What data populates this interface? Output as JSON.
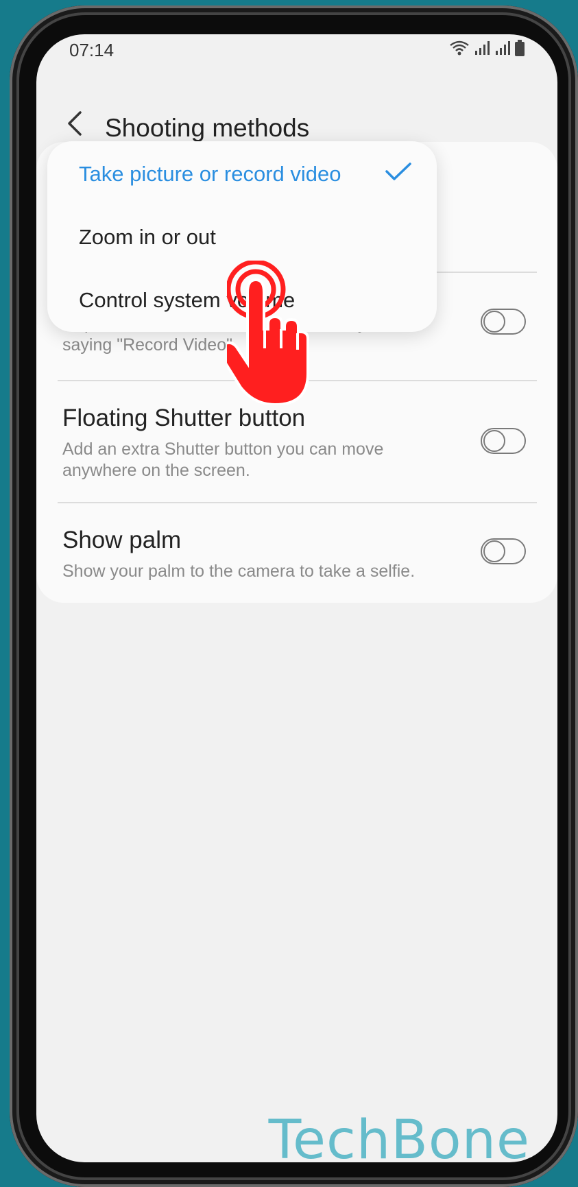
{
  "status": {
    "time": "07:14"
  },
  "header": {
    "title": "Shooting methods"
  },
  "popup": {
    "options": [
      {
        "label": "Take picture or record video",
        "selected": true
      },
      {
        "label": "Zoom in or out",
        "selected": false
      },
      {
        "label": "Control system volume",
        "selected": false
      }
    ]
  },
  "settings": {
    "hidden_desc_partial": "Capture\", or \"Shoot\" or record videos by saying \"Record Video\".",
    "floating_shutter": {
      "title": "Floating Shutter button",
      "desc": "Add an extra Shutter button you can move anywhere on the screen.",
      "enabled": false
    },
    "show_palm": {
      "title": "Show palm",
      "desc": "Show your palm to the camera to take a selfie.",
      "enabled": false
    },
    "voice_commands_enabled": false
  },
  "colors": {
    "accent": "#2a8ee0",
    "hand": "#ff1f1f",
    "background": "#167b8b"
  },
  "watermark": "TechBone"
}
